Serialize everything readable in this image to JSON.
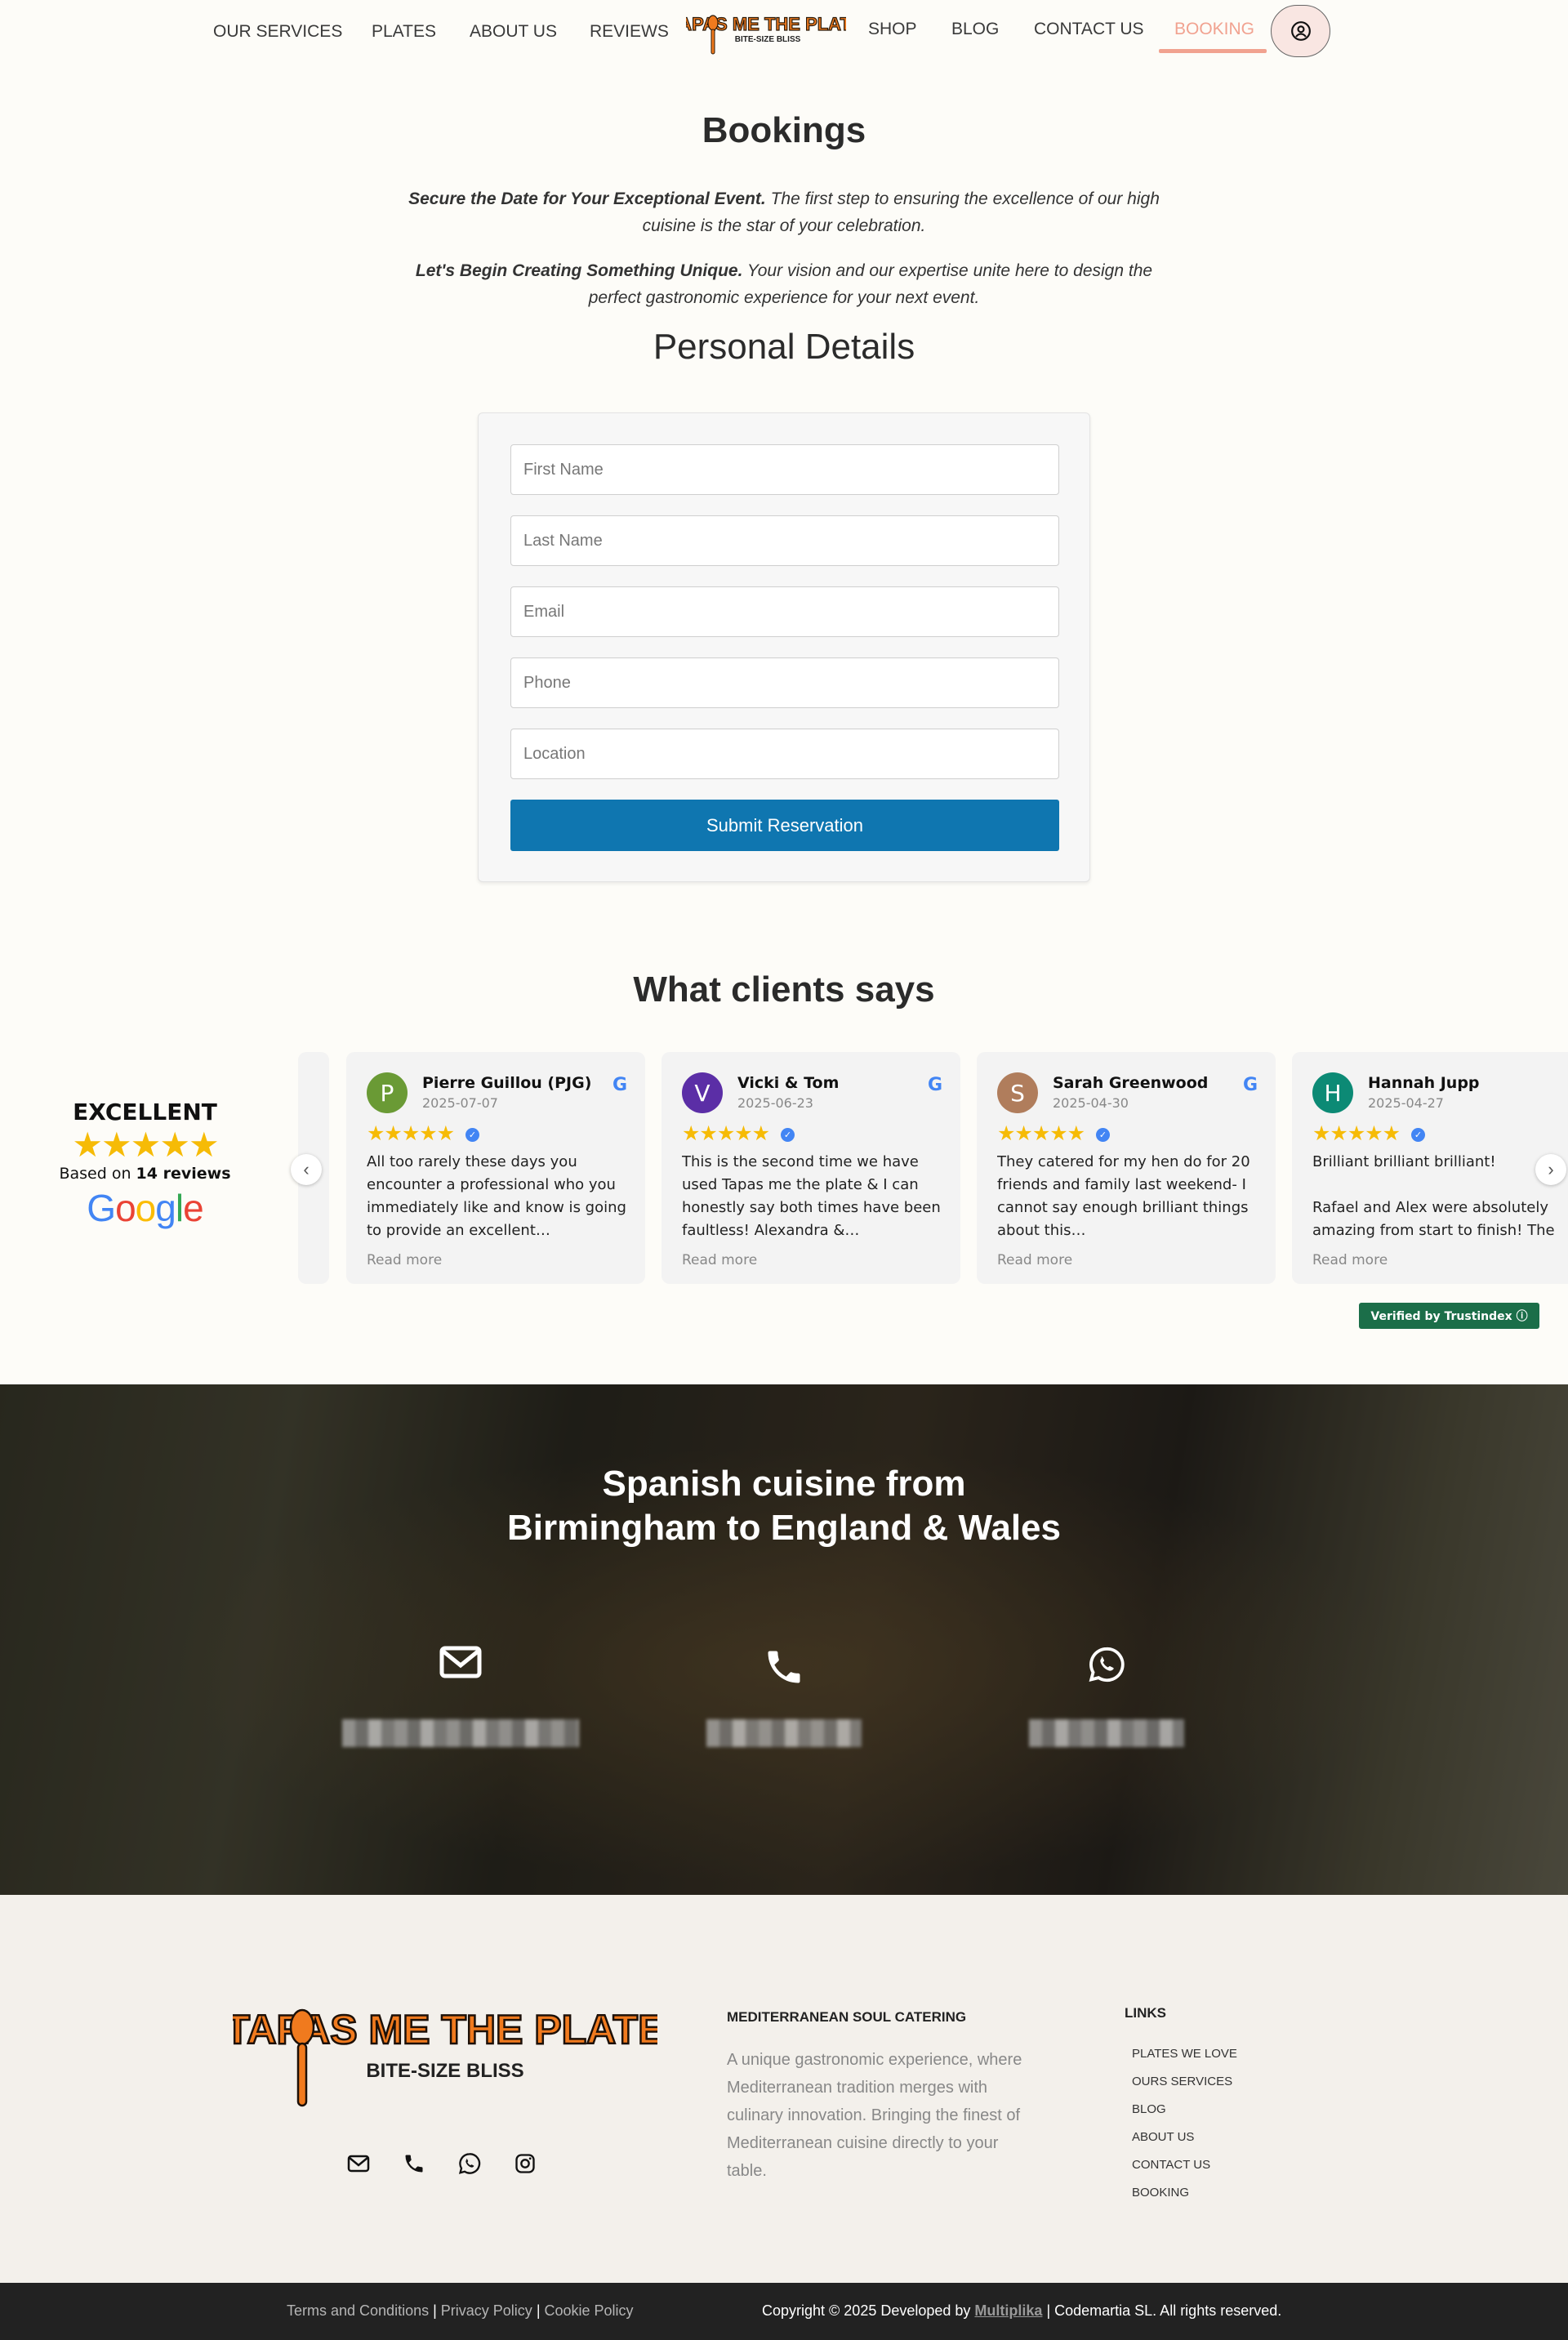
{
  "nav": {
    "items": [
      "OUR SERVICES",
      "PLATES",
      "ABOUT US",
      "REVIEWS",
      "SHOP",
      "BLOG",
      "CONTACT US",
      "BOOKING"
    ],
    "logo_main": "TAPAS ME THE PLATE",
    "logo_sub": "BITE-SIZE BLISS",
    "accent": "#f1a290"
  },
  "bookings": {
    "title": "Bookings",
    "p1_bold": "Secure the Date for Your Exceptional Event.",
    "p1_text": " The first step to ensuring the excellence of our high cuisine is the star of your celebration.",
    "p2_bold": "Let's Begin Creating Something Unique.",
    "p2_text": " Your vision and our expertise unite here to design the perfect gastronomic experience for your next event."
  },
  "form": {
    "heading": "Personal Details",
    "first_name": "First Name",
    "last_name": "Last Name",
    "email": "Email",
    "phone": "Phone",
    "location": "Location",
    "submit": "Submit Reservation",
    "submit_color": "#0f76b0"
  },
  "reviews": {
    "heading": "What clients says",
    "summary": {
      "label": "EXCELLENT",
      "stars": "★★★★★",
      "based_prefix": "Based on ",
      "count": "14 reviews",
      "brand": "Google"
    },
    "cards": [
      {
        "initial": "P",
        "avatar_color": "#6a9a35",
        "name": "Pierre Guillou (PJG)",
        "date": "2025-07-07",
        "stars": "★★★★★",
        "text": "All too rarely these days you encounter a professional who you immediately like and know is going to provide an excellent…",
        "more": "Read more"
      },
      {
        "initial": "V",
        "avatar_color": "#5b2ea6",
        "name": "Vicki & Tom",
        "date": "2025-06-23",
        "stars": "★★★★★",
        "text": "This is the second time we have used Tapas me the plate & I can honestly say both times have been faultless! Alexandra &…",
        "more": "Read more"
      },
      {
        "initial": "S",
        "avatar_color": "#b07d5c",
        "name": "Sarah Greenwood",
        "date": "2025-04-30",
        "stars": "★★★★★",
        "text": "They catered for my hen do for 20 friends and family last weekend- I cannot say enough brilliant things about this…",
        "more": "Read more"
      },
      {
        "initial": "H",
        "avatar_color": "#0c8a75",
        "name": "Hannah Jupp",
        "date": "2025-04-27",
        "stars": "★★★★★",
        "text": "Brilliant brilliant brilliant!\n\nRafael and Alex were absolutely amazing from start to finish! The",
        "more": "Read more"
      }
    ],
    "verified": "Verified by Trustindex ⓘ"
  },
  "hero": {
    "title_line1": "Spanish cuisine from",
    "title_line2": "Birmingham to England & Wales",
    "contacts": [
      "mail-icon",
      "phone-icon",
      "whatsapp-icon"
    ]
  },
  "footer": {
    "logo_main": "TAPAS ME THE PLATE",
    "logo_sub": "BITE-SIZE BLISS",
    "about_title": "MEDITERRANEAN SOUL CATERING",
    "about_text": "A unique gastronomic experience, where Mediterranean tradition merges with culinary innovation. Bringing the finest of Mediterranean cuisine directly to your table.",
    "links_title": "LINKS",
    "links": [
      "PLATES WE LOVE",
      "OURS SERVICES",
      "BLOG",
      "ABOUT US",
      "CONTACT US",
      "BOOKING"
    ]
  },
  "bottom": {
    "terms": "Terms and Conditions",
    "privacy": "Privacy Policy",
    "cookie": "Cookie Policy",
    "sep": " | ",
    "copy_prefix": "Copyright © 2025 Developed by ",
    "developer": "Multiplika",
    "copy_suffix": " | Codemartia SL. All rights reserved."
  }
}
